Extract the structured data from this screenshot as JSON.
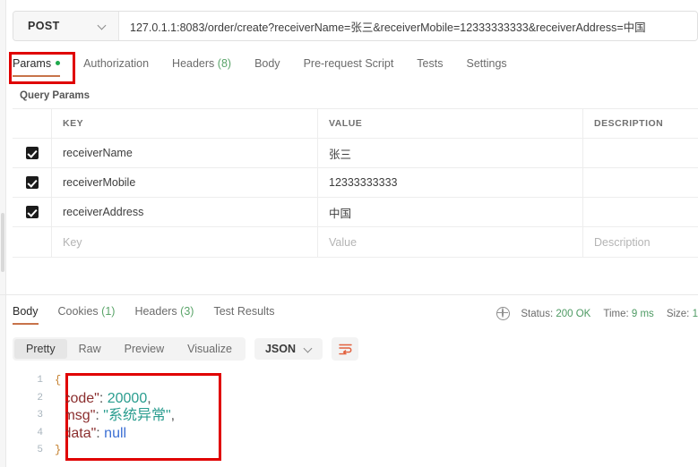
{
  "request": {
    "method": "POST",
    "method_caret_icon": "chevron-down-icon",
    "url": "127.0.1.1:8083/order/create?receiverName=张三&receiverMobile=12333333333&receiverAddress=中国",
    "tabs": [
      {
        "label": "Params",
        "active": true,
        "dot": true
      },
      {
        "label": "Authorization",
        "active": false
      },
      {
        "label": "Headers",
        "count": "(8)",
        "active": false
      },
      {
        "label": "Body",
        "active": false
      },
      {
        "label": "Pre-request Script",
        "active": false
      },
      {
        "label": "Tests",
        "active": false
      },
      {
        "label": "Settings",
        "active": false
      }
    ]
  },
  "query_params": {
    "section_title": "Query Params",
    "columns": [
      "KEY",
      "VALUE",
      "DESCRIPTION"
    ],
    "rows": [
      {
        "checked": true,
        "key": "receiverName",
        "value": "张三",
        "description": ""
      },
      {
        "checked": true,
        "key": "receiverMobile",
        "value": "12333333333",
        "description": ""
      },
      {
        "checked": true,
        "key": "receiverAddress",
        "value": "中国",
        "description": ""
      }
    ],
    "empty_row": {
      "key": "Key",
      "value": "Value",
      "description": "Description"
    }
  },
  "response": {
    "tabs": [
      {
        "label": "Body",
        "active": true
      },
      {
        "label": "Cookies",
        "count": "(1)",
        "active": false
      },
      {
        "label": "Headers",
        "count": "(3)",
        "active": false
      },
      {
        "label": "Test Results",
        "active": false
      }
    ],
    "meta": {
      "globe_icon": "globe-icon",
      "status_label": "Status:",
      "status_value": "200 OK",
      "time_label": "Time:",
      "time_value": "9 ms",
      "size_label": "Size:",
      "size_value": "1"
    },
    "viewer": {
      "modes": [
        {
          "label": "Pretty",
          "active": true
        },
        {
          "label": "Raw",
          "active": false
        },
        {
          "label": "Preview",
          "active": false
        },
        {
          "label": "Visualize",
          "active": false
        }
      ],
      "format": "JSON",
      "format_caret_icon": "chevron-down-icon",
      "wrap_icon": "word-wrap-icon"
    },
    "body": {
      "line_numbers": [
        "1",
        "2",
        "3",
        "4",
        "5"
      ],
      "lines": [
        {
          "tokens": [
            {
              "t": "brace",
              "v": "{"
            }
          ]
        },
        {
          "tokens": [
            {
              "t": "plain",
              "v": "    "
            },
            {
              "t": "key",
              "v": "\"code\""
            },
            {
              "t": "punct",
              "v": ": "
            },
            {
              "t": "num",
              "v": "20000"
            },
            {
              "t": "punct",
              "v": ","
            }
          ]
        },
        {
          "tokens": [
            {
              "t": "plain",
              "v": "    "
            },
            {
              "t": "key",
              "v": "\"msg\""
            },
            {
              "t": "punct",
              "v": ": "
            },
            {
              "t": "str",
              "v": "\"系统异常\""
            },
            {
              "t": "punct",
              "v": ","
            }
          ]
        },
        {
          "tokens": [
            {
              "t": "plain",
              "v": "    "
            },
            {
              "t": "key",
              "v": "\"data\""
            },
            {
              "t": "punct",
              "v": ": "
            },
            {
              "t": "null",
              "v": "null"
            }
          ]
        },
        {
          "tokens": [
            {
              "t": "brace",
              "v": "}"
            }
          ]
        }
      ]
    }
  },
  "annotations": {
    "params_box_color": "#e00000",
    "json_box_color": "#e00000"
  }
}
